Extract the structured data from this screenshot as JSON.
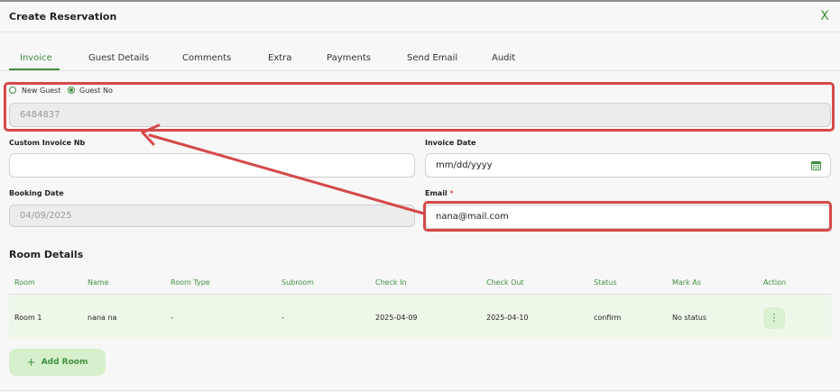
{
  "modal": {
    "title": "Create Reservation",
    "close_glyph": "X"
  },
  "tabs": [
    {
      "label": "Invoice"
    },
    {
      "label": "Guest Details"
    },
    {
      "label": "Comments"
    },
    {
      "label": "Extra"
    },
    {
      "label": "Payments"
    },
    {
      "label": "Send Email"
    },
    {
      "label": "Audit"
    }
  ],
  "guest_type": {
    "new_guest": "New Guest",
    "guest_no": "Guest No",
    "selected": "guest_no"
  },
  "fields": {
    "guest_no_value": "6484837",
    "custom_invoice_label": "Custom Invoice Nb",
    "custom_invoice_value": "",
    "invoice_date_label": "Invoice Date",
    "invoice_date_placeholder": "mm/dd/yyyy",
    "booking_date_label": "Booking Date",
    "booking_date_value": "04/09/2025",
    "email_label": "Email",
    "email_required": "*",
    "email_value": "nana@mail.com"
  },
  "room_details": {
    "title": "Room Details",
    "columns": [
      "Room",
      "Name",
      "Room Type",
      "Subroom",
      "Check In",
      "Check Out",
      "Status",
      "Mark As",
      "Action"
    ],
    "rows": [
      [
        "Room 1",
        "nana na",
        "-",
        "-",
        "2025-04-09",
        "2025-04-10",
        "confirm",
        "No status"
      ]
    ],
    "action_glyph": "⋮",
    "add_room_label": "Add Room",
    "add_room_glyph": "+"
  },
  "colors": {
    "accent": "#3f8f3f",
    "annotation": "#d6494a",
    "row_highlight": "#eef8e9"
  }
}
